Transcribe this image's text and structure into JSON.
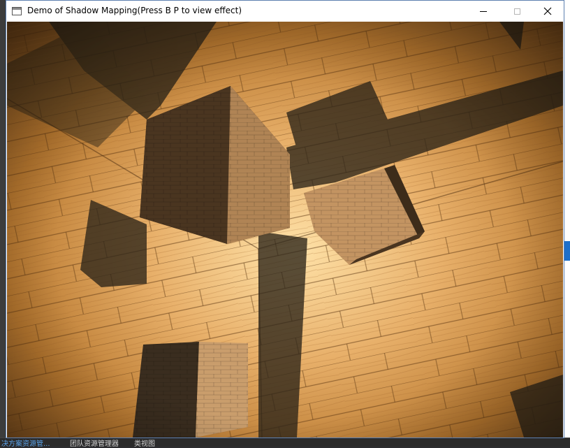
{
  "window": {
    "title": "Demo of Shadow Mapping(Press B P to view effect)",
    "buttons": {
      "minimize": "minimize",
      "maximize": "maximize",
      "close": "close"
    }
  },
  "scene": {
    "description_icons": [
      "wood-floor",
      "cube",
      "shadow",
      "point-light"
    ],
    "colors": {
      "wood_light": "#e8b878",
      "wood_mid": "#c98a45",
      "wood_dark": "#6b4a25",
      "shadow": "#2c2418"
    }
  },
  "background_fragments": {
    "bottom_texts": [
      "决方案资源管...",
      "团队资源管理器",
      "类视图"
    ]
  }
}
